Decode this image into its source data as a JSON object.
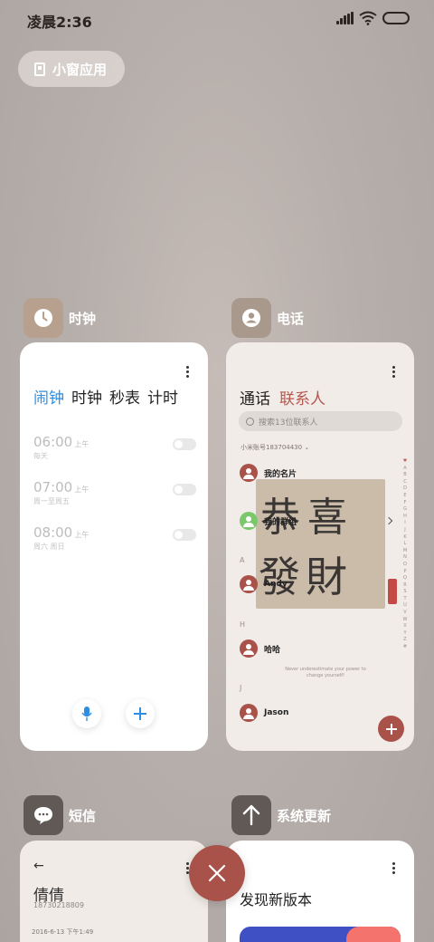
{
  "status_bar": {
    "time": "凌晨2:36"
  },
  "mini_window": {
    "label": "小窗应用"
  },
  "clock": {
    "app_name": "时钟",
    "tabs": [
      "闹钟",
      "时钟",
      "秒表",
      "计时"
    ],
    "alarms": [
      {
        "time": "06:00",
        "ampm": "上午",
        "repeat": "每天"
      },
      {
        "time": "07:00",
        "ampm": "上午",
        "repeat": "周一至周五"
      },
      {
        "time": "08:00",
        "ampm": "上午",
        "repeat": "周六 周日"
      }
    ]
  },
  "phone": {
    "app_name": "电话",
    "tabs": [
      "通话",
      "联系人"
    ],
    "search_placeholder": "搜索13位联系人",
    "account": "小米账号183704430",
    "contacts": [
      {
        "name": "我的名片"
      },
      {
        "name": "我的群组"
      },
      {
        "name": "Andy"
      },
      {
        "name": "哈哈"
      },
      {
        "name": "Jason"
      }
    ],
    "sections": [
      "A",
      "H",
      "J"
    ],
    "alphabet": [
      "♥",
      "A",
      "B",
      "C",
      "D",
      "E",
      "F",
      "G",
      "H",
      "I",
      "J",
      "K",
      "L",
      "M",
      "N",
      "O",
      "P",
      "Q",
      "R",
      "S",
      "T",
      "U",
      "V",
      "W",
      "X",
      "Y",
      "Z",
      "#"
    ],
    "motto": "Never underestimate your power to change yourself!",
    "wallpaper_text_top": "恭喜",
    "wallpaper_text_bottom": "發財"
  },
  "sms": {
    "app_name": "短信",
    "contact_name": "倩倩",
    "number": "18730218809",
    "date": "2016-6-13 下午1:49"
  },
  "update": {
    "app_name": "系统更新",
    "title": "发现新版本"
  },
  "colors": {
    "accent_blue": "#2b8ee0",
    "contact_red": "#b3574f",
    "close_button": "#a9524a",
    "green_avatar": "#7bc86c"
  }
}
